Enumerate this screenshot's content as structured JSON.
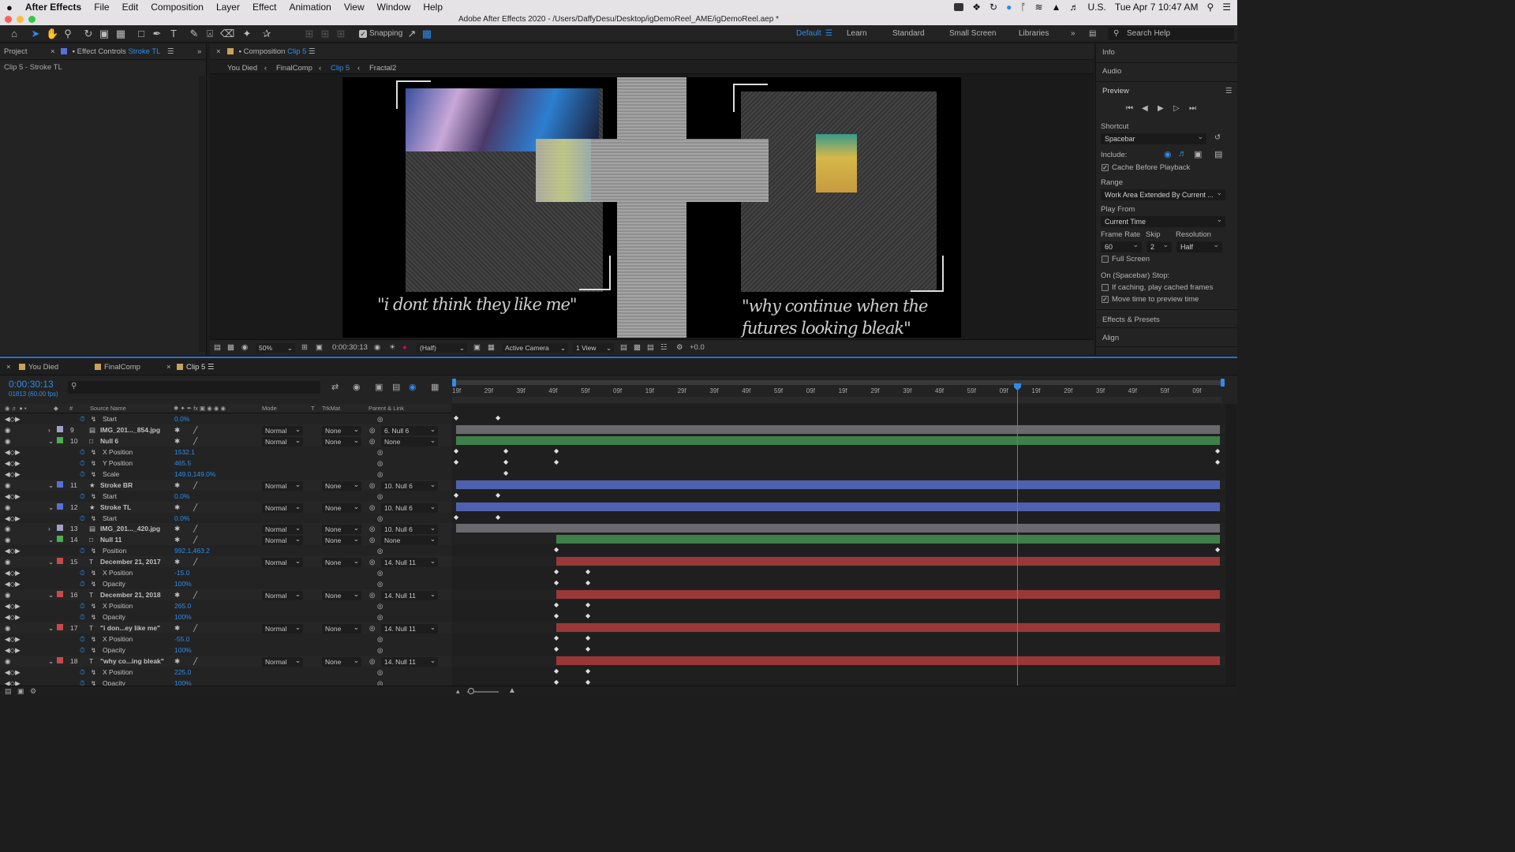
{
  "menubar": {
    "apple": "",
    "items": [
      "After Effects",
      "File",
      "Edit",
      "Composition",
      "Layer",
      "Effect",
      "Animation",
      "View",
      "Window",
      "Help"
    ],
    "input_source": "U.S.",
    "datetime": "Tue Apr 7  10:47 AM"
  },
  "window": {
    "title": "Adobe After Effects 2020 - /Users/DaffyDesu/Desktop/igDemoReel_AME/igDemoReel.aep *"
  },
  "toolbar": {
    "snapping_label": "Snapping",
    "snapping_checked": true,
    "workspaces": [
      "Default",
      "Learn",
      "Standard",
      "Small Screen",
      "Libraries"
    ],
    "active_workspace": "Default",
    "search_placeholder": "Search Help"
  },
  "left_panel": {
    "tab_project": "Project",
    "tab_effect_controls_prefix": "Effect Controls",
    "tab_effect_controls_layer": "Stroke TL",
    "breadcrumb": "Clip 5 - Stroke TL"
  },
  "viewer": {
    "tab_prefix": "Composition",
    "tab_comp": "Clip 5",
    "breadcrumbs": [
      "You Died",
      "FinalComp",
      "Clip 5",
      "Fractal2"
    ],
    "active_breadcrumb": "Clip 5",
    "caption_left": "\"i dont think they like me\"",
    "caption_right_line1": "\"why continue when the",
    "caption_right_line2": "futures looking bleak\"",
    "zoom": "50%",
    "timecode": "0:00:30:13",
    "resolution": "(Half)",
    "camera": "Active Camera",
    "views": "1 View",
    "exposure": "+0.0"
  },
  "right_panel": {
    "info": "Info",
    "audio": "Audio",
    "preview": "Preview",
    "shortcut_label": "Shortcut",
    "shortcut_value": "Spacebar",
    "include_label": "Include:",
    "cache_before_playback": "Cache Before Playback",
    "range_label": "Range",
    "range_value": "Work Area Extended By Current ...",
    "play_from_label": "Play From",
    "play_from_value": "Current Time",
    "frame_rate_label": "Frame Rate",
    "skip_label": "Skip",
    "resolution_label": "Resolution",
    "frame_rate_value": "60",
    "skip_value": "2",
    "resolution_value": "Half",
    "full_screen": "Full Screen",
    "on_stop_label": "On (Spacebar) Stop:",
    "if_caching": "If caching, play cached frames",
    "move_time": "Move time to preview time",
    "effects_presets": "Effects & Presets",
    "align": "Align"
  },
  "timeline": {
    "tabs": [
      "You Died",
      "FinalComp",
      "Clip 5"
    ],
    "active_tab": "Clip 5",
    "current_time": "0:00:30:13",
    "frame_info": "01813 (60.00 fps)",
    "columns": {
      "num": "#",
      "source": "Source Name",
      "mode": "Mode",
      "t": "T",
      "trkmat": "TrkMat",
      "parent": "Parent & Link"
    },
    "ruler_labels": [
      "19f",
      "29f",
      "39f",
      "49f",
      "59f",
      "09f",
      "19f",
      "29f",
      "39f",
      "49f",
      "59f",
      "09f",
      "19f",
      "29f",
      "39f",
      "49f",
      "59f",
      "09f",
      "19f",
      "29f",
      "39f",
      "49f",
      "59f",
      "09f"
    ],
    "rows": [
      {
        "type": "prop",
        "name": "Start",
        "value": "0.0%"
      },
      {
        "type": "layer",
        "num": "9",
        "name": "IMG_201..._854.jpg",
        "icon": "image",
        "mode": "Normal",
        "trk": "None",
        "parent": "6. Null 6",
        "color": "#a0a0c8",
        "expanded": false
      },
      {
        "type": "layer",
        "num": "10",
        "name": "Null 6",
        "icon": "null",
        "mode": "Normal",
        "trk": "None",
        "parent": "None",
        "color": "#4caf50",
        "expanded": true
      },
      {
        "type": "prop",
        "name": "X Position",
        "value": "1532.1"
      },
      {
        "type": "prop",
        "name": "Y Position",
        "value": "465.5"
      },
      {
        "type": "prop",
        "name": "Scale",
        "value": "149.0,149.0%"
      },
      {
        "type": "layer",
        "num": "11",
        "name": "Stroke BR",
        "icon": "shape",
        "mode": "Normal",
        "trk": "None",
        "parent": "10. Null 6",
        "color": "#5a6fd6",
        "expanded": true
      },
      {
        "type": "prop",
        "name": "Start",
        "value": "0.0%"
      },
      {
        "type": "layer",
        "num": "12",
        "name": "Stroke TL",
        "icon": "shape",
        "mode": "Normal",
        "trk": "None",
        "parent": "10. Null 6",
        "color": "#5a6fd6",
        "expanded": true
      },
      {
        "type": "prop",
        "name": "Start",
        "value": "0.0%"
      },
      {
        "type": "layer",
        "num": "13",
        "name": "IMG_201..._420.jpg",
        "icon": "image",
        "mode": "Normal",
        "trk": "None",
        "parent": "10. Null 6",
        "color": "#a0a0c8",
        "expanded": false
      },
      {
        "type": "layer",
        "num": "14",
        "name": "Null 11",
        "icon": "null",
        "mode": "Normal",
        "trk": "None",
        "parent": "None",
        "color": "#4caf50",
        "expanded": true
      },
      {
        "type": "prop",
        "name": "Position",
        "value": "992.1,463.2"
      },
      {
        "type": "layer",
        "num": "15",
        "name": "December 21, 2017",
        "icon": "text",
        "mode": "Normal",
        "trk": "None",
        "parent": "14. Null 11",
        "color": "#c84a4a",
        "expanded": true
      },
      {
        "type": "prop",
        "name": "X Position",
        "value": "-15.0"
      },
      {
        "type": "prop",
        "name": "Opacity",
        "value": "100%"
      },
      {
        "type": "layer",
        "num": "16",
        "name": "December 21, 2018",
        "icon": "text",
        "mode": "Normal",
        "trk": "None",
        "parent": "14. Null 11",
        "color": "#c84a4a",
        "expanded": true
      },
      {
        "type": "prop",
        "name": "X Position",
        "value": "265.0"
      },
      {
        "type": "prop",
        "name": "Opacity",
        "value": "100%"
      },
      {
        "type": "layer",
        "num": "17",
        "name": "\"i don...ey like me\"",
        "icon": "text",
        "mode": "Normal",
        "trk": "None",
        "parent": "14. Null 11",
        "color": "#c84a4a",
        "expanded": true
      },
      {
        "type": "prop",
        "name": "X Position",
        "value": "-55.0"
      },
      {
        "type": "prop",
        "name": "Opacity",
        "value": "100%"
      },
      {
        "type": "layer",
        "num": "18",
        "name": "\"why co...ing bleak\"",
        "icon": "text",
        "mode": "Normal",
        "trk": "None",
        "parent": "14. Null 11",
        "color": "#c84a4a",
        "expanded": true
      },
      {
        "type": "prop",
        "name": "X Position",
        "value": "225.0"
      },
      {
        "type": "prop",
        "name": "Opacity",
        "value": "100%"
      }
    ]
  }
}
